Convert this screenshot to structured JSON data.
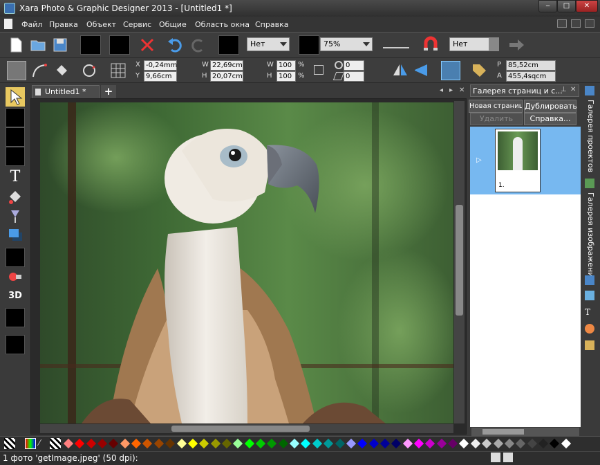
{
  "window": {
    "title": "Xara Photo & Graphic Designer 2013 - [Untitled1 *]",
    "minimize": "‒",
    "maximize": "□",
    "close": "✕"
  },
  "menu": {
    "items": [
      "Файл",
      "Правка",
      "Объект",
      "Сервис",
      "Общие",
      "Область окна",
      "Справка"
    ]
  },
  "toolbar1": {
    "quality_value": "Нет",
    "zoom_value": "75%",
    "snap_value": "Нет"
  },
  "toolbar2": {
    "x_label": "X",
    "x_value": "-0,24mm",
    "y_label": "Y",
    "y_value": "9,66cm",
    "w_label": "W",
    "w_value": "22,69cm",
    "h_label": "H",
    "h_value": "20,07cm",
    "wpct_label": "W",
    "wpct_value": "100",
    "hpct_label": "H",
    "hpct_value": "100",
    "pct_unit": "%",
    "rotate_value": "0",
    "skew_value": "0",
    "p_label": "P",
    "p_value": "85,52cm",
    "a_label": "A",
    "a_value": "455,4sqcm"
  },
  "document": {
    "tab_label": "Untitled1 *",
    "add_tab": "+"
  },
  "gallery": {
    "title": "Галерея страниц и с...",
    "new_page_button": "Новая страница",
    "duplicate_button": "Дублировать",
    "delete_button": "Удалить",
    "help_button": "Справка...",
    "page_number": "1."
  },
  "right_tabs": {
    "projects": "Галерея проектов",
    "images": "Галерея изображений"
  },
  "status": {
    "text": "1 фото 'getImage.jpeg' (50 dpi):"
  },
  "colors": {
    "accent": "#77b8f0",
    "palette": [
      "#ff7f7f",
      "#ff0000",
      "#cc0000",
      "#990000",
      "#660000",
      "#ff9966",
      "#ff6600",
      "#cc5500",
      "#994400",
      "#663300",
      "#ffff99",
      "#ffff00",
      "#cccc00",
      "#999900",
      "#666600",
      "#99ff99",
      "#00ff00",
      "#00cc00",
      "#009900",
      "#006600",
      "#99ffff",
      "#00ffff",
      "#00cccc",
      "#009999",
      "#006666",
      "#9999ff",
      "#0000ff",
      "#0000cc",
      "#000099",
      "#000066",
      "#ff99ff",
      "#ff00ff",
      "#cc00cc",
      "#990099",
      "#660066",
      "#ffffff",
      "#eeeeee",
      "#cccccc",
      "#aaaaaa",
      "#888888",
      "#666666",
      "#444444",
      "#222222",
      "#000000",
      "#ffffff"
    ]
  }
}
